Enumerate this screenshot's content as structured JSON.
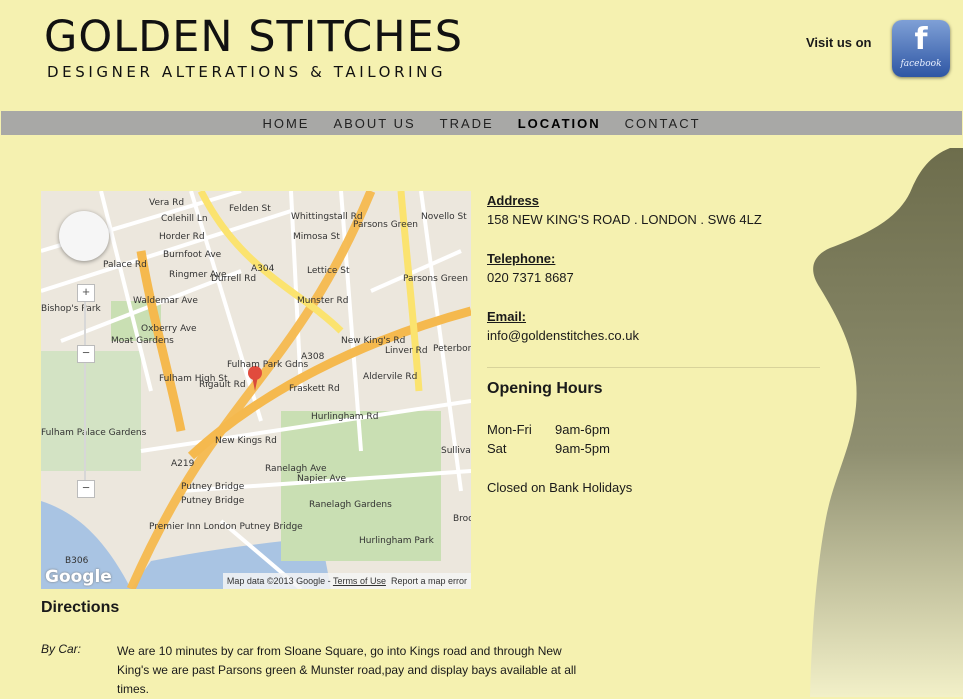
{
  "header": {
    "title": "GOLDEN STITCHES",
    "subtitle": "DESIGNER ALTERATIONS & TAILORING",
    "visit_us": "Visit us on",
    "facebook_letter": "f",
    "facebook_text": "facebook"
  },
  "nav": {
    "items": [
      "HOME",
      "ABOUT US",
      "TRADE",
      "LOCATION",
      "CONTACT"
    ],
    "active": "LOCATION"
  },
  "map": {
    "attribution": "Map data ©2013 Google - ",
    "terms": "Terms of Use",
    "report": "Report a map error",
    "google": "Google",
    "labels": [
      "Vera Rd",
      "Colehill Ln",
      "Horder Rd",
      "Burnfoot Ave",
      "Ringmer Ave",
      "Waldemar Ave",
      "Oxberry Ave",
      "Felden St",
      "Durrell Rd",
      "Whittingstall Rd",
      "Mimosa St",
      "Lettice St",
      "Munster Rd",
      "Parsons Green",
      "Novello St",
      "Parsons Green",
      "Peterborough Rd",
      "Palace Rd",
      "Bishop's Park",
      "Moat Gardens",
      "Fulham High St",
      "Rigault Rd",
      "New Kings Rd",
      "New King's Rd",
      "Aldervile Rd",
      "Linver Rd",
      "Fulham Palace Gardens",
      "Hurlingham Rd",
      "Ranelagh Ave",
      "Napier Ave",
      "Putney Bridge",
      "Premier Inn London Putney Bridge",
      "Ranelagh Gardens",
      "Hurlingham Park",
      "Broomhouse",
      "Sullivan",
      "A219",
      "A304",
      "A308",
      "B306",
      "Putney Bridge",
      "Fulham Park Gdns",
      "Fraskett Rd"
    ],
    "zoom_in": "+",
    "zoom_out": "−",
    "zoom_min": "−"
  },
  "contact": {
    "address_label": "Address",
    "address": "158 NEW KING'S ROAD . LONDON . SW6 4LZ",
    "telephone_label": "Telephone:",
    "telephone": "020 7371 8687",
    "email_label": "Email:",
    "email": "info@goldenstitches.co.uk"
  },
  "hours": {
    "title": "Opening Hours",
    "rows": [
      {
        "day": "Mon-Fri",
        "time": "9am-6pm"
      },
      {
        "day": "Sat",
        "time": "9am-5pm"
      }
    ],
    "note": "Closed on Bank Holidays"
  },
  "directions": {
    "title": "Directions",
    "by_car_label": "By Car:",
    "by_car_text": "We are 10 minutes by car from Sloane Square, go into Kings road and through New King's we are past Parsons green & Munster road,pay and display bays available at all times."
  }
}
